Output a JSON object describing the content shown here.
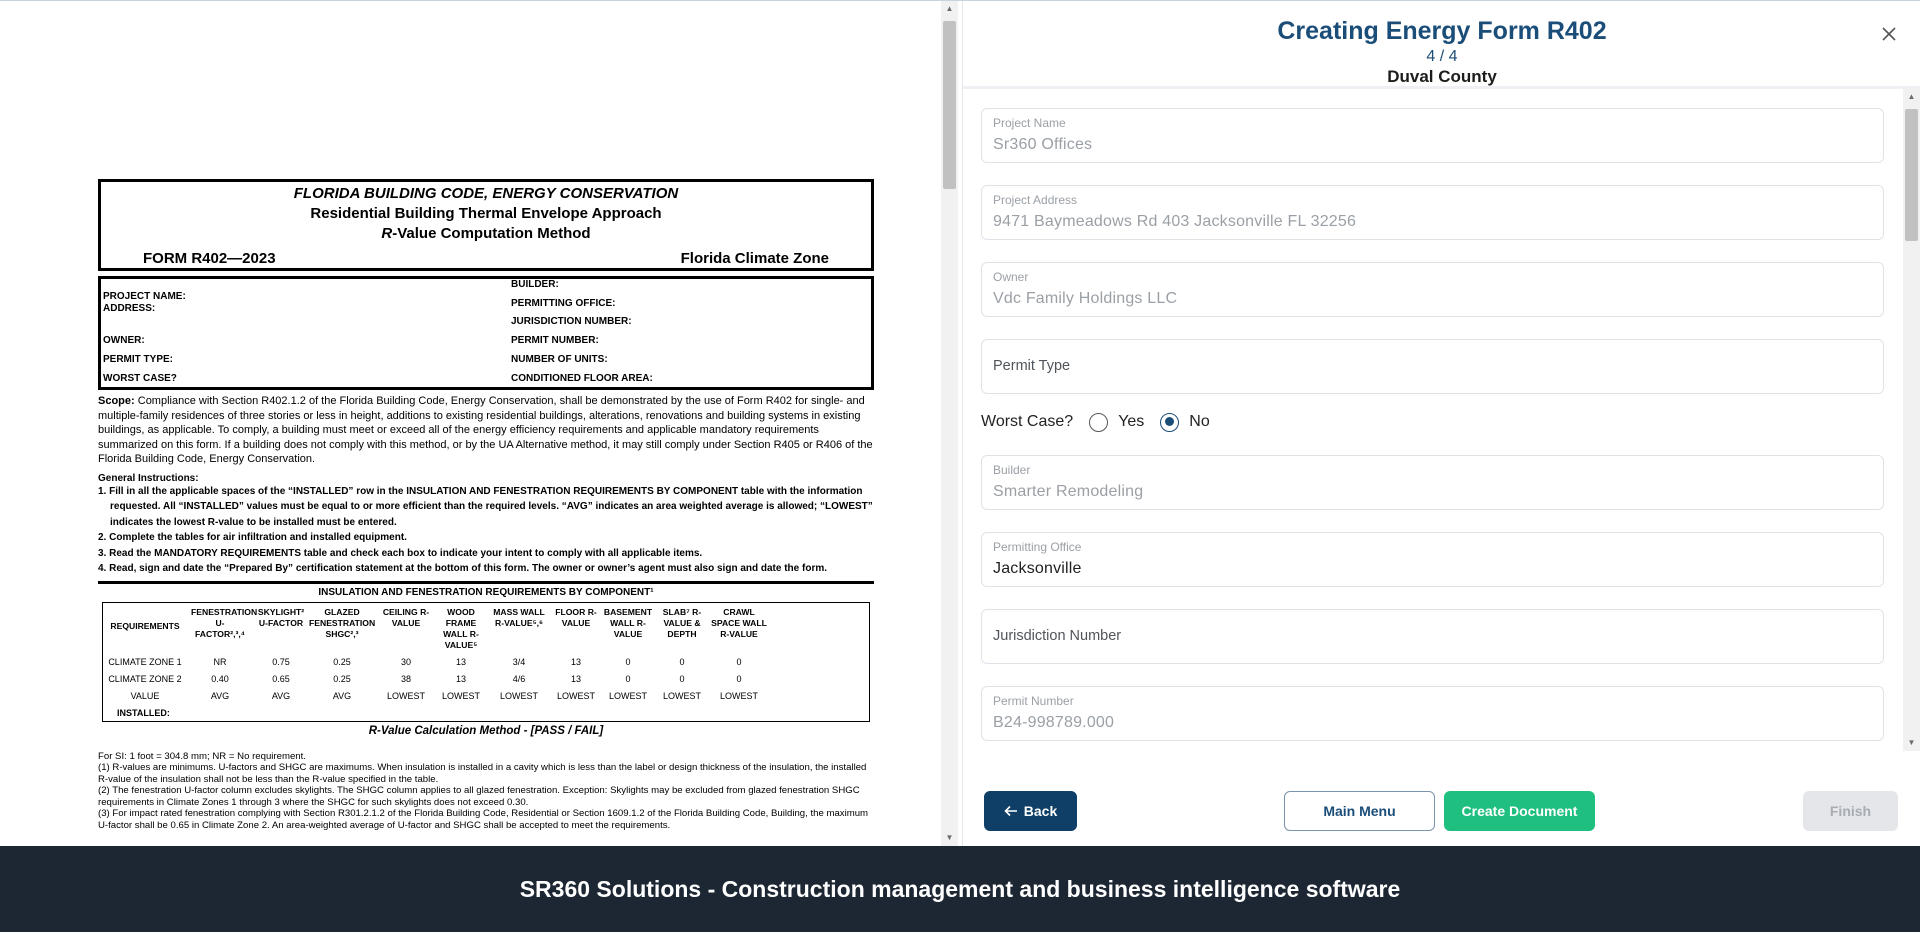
{
  "document": {
    "title_line1": "FLORIDA BUILDING CODE, ENERGY CONSERVATION",
    "title_line2": "Residential Building Thermal Envelope Approach",
    "title_line3_italic": "R",
    "title_line3_rest": "-Value Computation Method",
    "form_number": "FORM R402—2023",
    "climate_zone": "Florida Climate Zone",
    "info_left": [
      "PROJECT NAME:",
      "ADDRESS:",
      "OWNER:",
      "PERMIT TYPE:",
      "WORST CASE?"
    ],
    "info_right": [
      "BUILDER:",
      "PERMITTING OFFICE:",
      "JURISDICTION NUMBER:",
      "PERMIT NUMBER:",
      "NUMBER OF UNITS:",
      "CONDITIONED FLOOR AREA:"
    ],
    "scope_label": "Scope:",
    "scope_text": " Compliance with Section R402.1.2 of the Florida Building Code, Energy Conservation, shall be demonstrated by the use of Form R402 for single- and multiple-family residences of three stories or less in height, additions to existing residential buildings, alterations, renovations and building systems in existing buildings, as applicable. To comply, a building must meet or exceed all of the energy efficiency requirements and applicable mandatory requirements summarized on this form. If a building does not comply with this method, or by the UA Alternative method, it may still comply under Section R405 or R406 of the Florida Building Code, Energy Conservation.",
    "general_instructions_title": "General Instructions:",
    "general_instructions": [
      "1. Fill in all the applicable spaces of the “INSTALLED” row in the INSULATION AND FENESTRATION REQUIREMENTS BY COMPONENT table with the information requested. All “INSTALLED” values must be equal to or more efficient than the required levels. “AVG” indicates an area weighted average is allowed; “LOWEST” indicates the lowest R-value to be installed must be entered.",
      "2. Complete the tables for air infiltration and installed equipment.",
      "3. Read the MANDATORY REQUIREMENTS table and check each box to indicate your intent to comply with all applicable items.",
      "4. Read, sign and date the “Prepared By” certification statement at the bottom of this form. The owner or owner’s agent must also sign and date the form."
    ],
    "insulation_title": "INSULATION AND FENESTRATION REQUIREMENTS BY COMPONENT¹",
    "table_headers": [
      "REQUIREMENTS",
      "FENESTRATION U-FACTOR²,³,⁴",
      "SKYLIGHT² U-FACTOR",
      "GLAZED FENESTRATION SHGC²,³",
      "CEILING R-VALUE",
      "WOOD FRAME WALL R-VALUE⁵",
      "MASS WALL R-VALUE⁵,⁶",
      "FLOOR R-VALUE",
      "BASEMENT WALL R-VALUE",
      "SLAB⁷ R-VALUE & DEPTH",
      "CRAWL SPACE WALL R-VALUE"
    ],
    "table_rows": [
      [
        "CLIMATE ZONE 1",
        "NR",
        "0.75",
        "0.25",
        "30",
        "13",
        "3/4",
        "13",
        "0",
        "0",
        "0"
      ],
      [
        "CLIMATE ZONE 2",
        "0.40",
        "0.65",
        "0.25",
        "38",
        "13",
        "4/6",
        "13",
        "0",
        "0",
        "0"
      ],
      [
        "VALUE",
        "AVG",
        "AVG",
        "AVG",
        "LOWEST",
        "LOWEST",
        "LOWEST",
        "LOWEST",
        "LOWEST",
        "LOWEST",
        "LOWEST"
      ],
      [
        "INSTALLED:",
        "",
        "",
        "",
        "",
        "",
        "",
        "",
        "",
        "",
        ""
      ]
    ],
    "calc_title": "R-Value Calculation Method - [PASS / FAIL]",
    "notes": [
      "For SI: 1 foot = 304.8 mm; NR = No requirement.",
      "(1) R-values are minimums. U-factors and SHGC are maximums. When insulation is installed in a cavity which is less than the label or design thickness of the insulation, the installed R-value of the insulation shall not be less than the R-value specified in the table.",
      "(2) The fenestration U-factor column excludes skylights. The SHGC column applies to all glazed fenestration. Exception: Skylights may be excluded from glazed fenestration SHGC requirements in Climate Zones 1 through 3 where the SHGC for such skylights does not exceed 0.30.",
      "(3) For impact rated fenestration complying with Section R301.2.1.2 of the Florida Building Code, Residential or Section 1609.1.2 of the Florida Building Code, Building, the maximum U-factor shall be 0.65 in Climate Zone 2. An area-weighted average of U-factor and SHGC shall be accepted to meet the requirements."
    ]
  },
  "wizard": {
    "title": "Creating Energy Form R402",
    "step": "4 / 4",
    "county": "Duval County",
    "fields": {
      "project_name": {
        "label": "Project Name",
        "value": "Sr360 Offices"
      },
      "project_address": {
        "label": "Project Address",
        "value": "9471 Baymeadows Rd 403 Jacksonville FL 32256"
      },
      "owner": {
        "label": "Owner",
        "value": "Vdc Family Holdings LLC"
      },
      "permit_type": {
        "placeholder": "Permit Type"
      },
      "builder": {
        "label": "Builder",
        "value": "Smarter Remodeling"
      },
      "permitting_office": {
        "label": "Permitting Office",
        "value": "Jacksonville"
      },
      "jurisdiction_number": {
        "placeholder": "Jurisdiction Number"
      },
      "permit_number": {
        "label": "Permit Number",
        "value": "B24-998789.000"
      }
    },
    "worst_case": {
      "label": "Worst Case?",
      "yes": "Yes",
      "no": "No",
      "selected": "No"
    },
    "buttons": {
      "back": "Back",
      "main_menu": "Main Menu",
      "create_document": "Create Document",
      "finish": "Finish"
    }
  },
  "banner": "SR360 Solutions - Construction management and business intelligence software",
  "colors": {
    "primary": "#1b4d79",
    "accent_green": "#1fbf7f",
    "banner_bg": "#1d2733"
  },
  "icons": {
    "close": "close-icon",
    "back": "arrow-left-icon"
  }
}
